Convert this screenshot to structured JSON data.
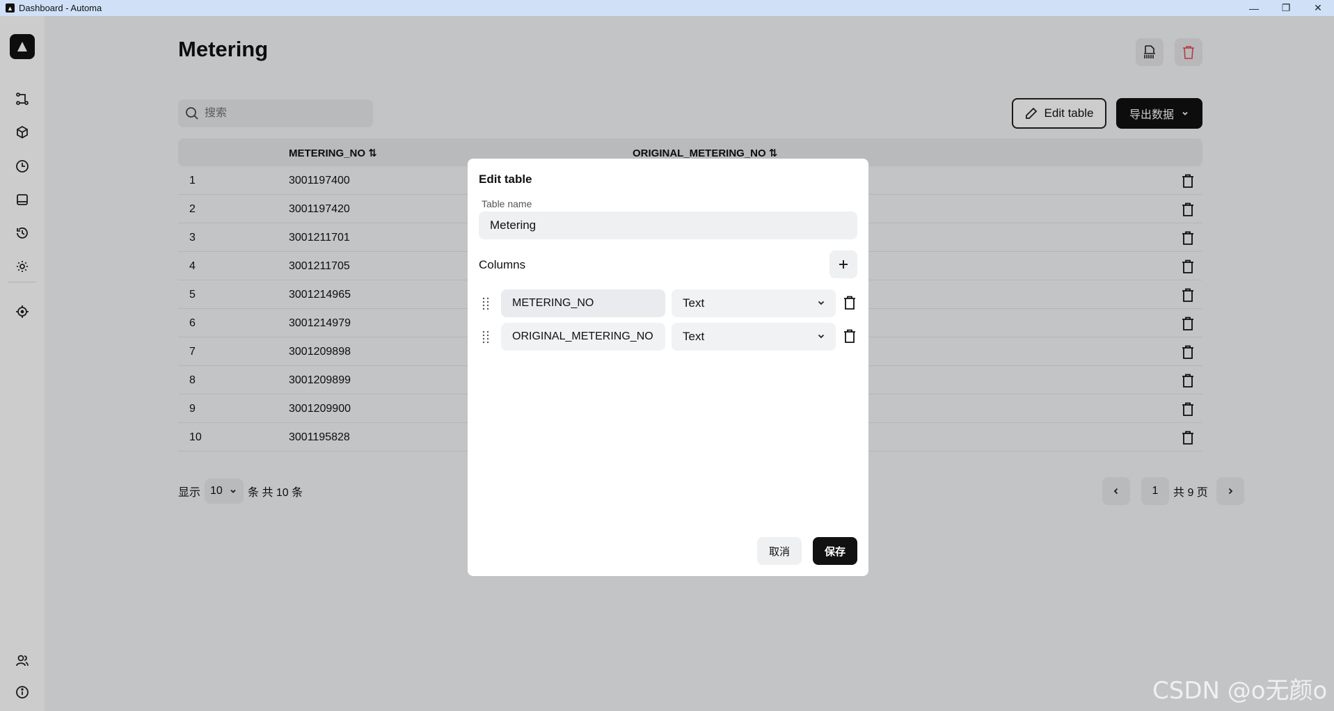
{
  "window": {
    "title": "Dashboard - Automa",
    "controls": [
      "—",
      "❐",
      "✕"
    ]
  },
  "page": {
    "title": "Metering",
    "search_placeholder": "搜索",
    "edit_table_label": "Edit table",
    "export_label": "导出数据"
  },
  "table": {
    "headers": [
      "METERING_NO",
      "ORIGINAL_METERING_NO"
    ],
    "rows": [
      {
        "index": "1",
        "metering_no": "3001197400"
      },
      {
        "index": "2",
        "metering_no": "3001197420"
      },
      {
        "index": "3",
        "metering_no": "3001211701"
      },
      {
        "index": "4",
        "metering_no": "3001211705"
      },
      {
        "index": "5",
        "metering_no": "3001214965"
      },
      {
        "index": "6",
        "metering_no": "3001214979"
      },
      {
        "index": "7",
        "metering_no": "3001209898"
      },
      {
        "index": "8",
        "metering_no": "3001209899"
      },
      {
        "index": "9",
        "metering_no": "3001209900"
      },
      {
        "index": "10",
        "metering_no": "3001195828"
      }
    ]
  },
  "footer": {
    "show_label": "显示",
    "per_page": "10",
    "total_label": "条 共 10 条",
    "current_page": "1",
    "total_pages_label": "共 9 页"
  },
  "modal": {
    "title": "Edit table",
    "table_name_label": "Table name",
    "table_name_value": "Metering",
    "columns_label": "Columns",
    "columns": [
      {
        "name": "METERING_NO",
        "type": "Text"
      },
      {
        "name": "ORIGINAL_METERING_NO",
        "type": "Text"
      }
    ],
    "cancel_label": "取消",
    "save_label": "保存"
  },
  "watermark": "CSDN @o无颜o",
  "colors": {
    "accent": "#111111",
    "danger": "#e5484d",
    "titlebar": "#cfe0f7"
  }
}
